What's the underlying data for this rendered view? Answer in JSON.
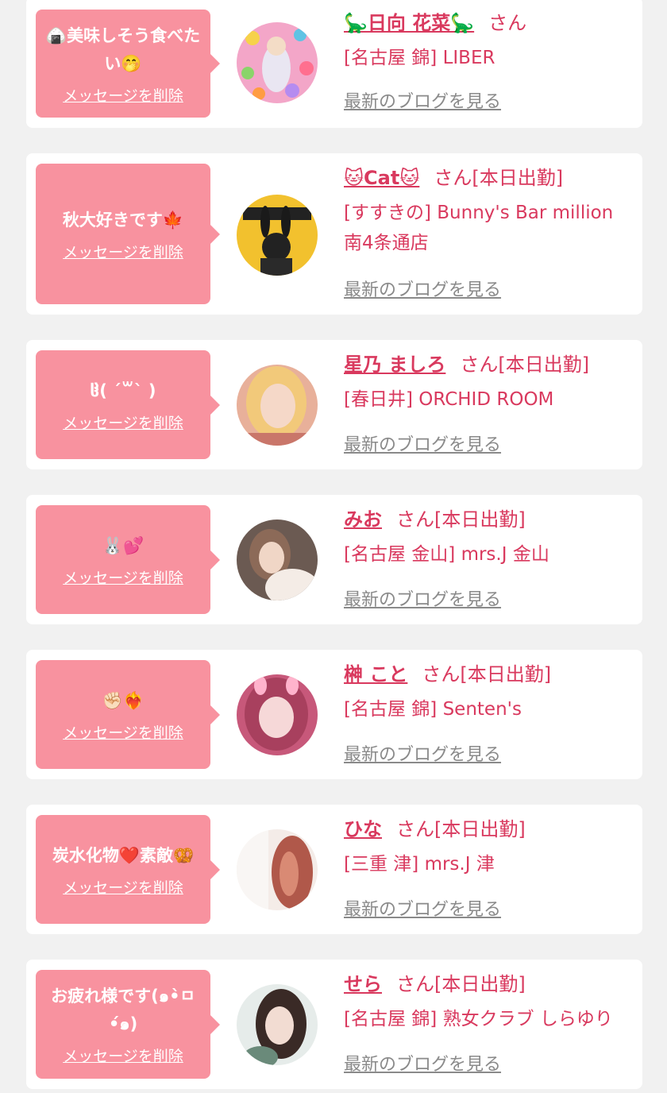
{
  "delete_label": "メッセージを削除",
  "blog_label": "最新のブログを見る",
  "colors": {
    "accent_pink": "#f8929f",
    "name_red": "#d9395e",
    "link_gray": "#8a8a8a",
    "background": "#f1f1f1"
  },
  "entries": [
    {
      "message": "🍙美味しそう食べたい🤭",
      "name": "🦕日向 花菜🦕",
      "suffix": "さん",
      "shop": "[名古屋 錦] LIBER",
      "avatar_icon": "avatar-photo"
    },
    {
      "message": "秋大好きです🍁",
      "name": "🐱Cat🐱",
      "suffix": "さん[本日出勤]",
      "shop": "[すすきの] Bunny's Bar million 南4条通店",
      "avatar_icon": "avatar-photo"
    },
    {
      "message": "ჱ̒( ˊ꒳ˋ )",
      "name": "星乃 ましろ",
      "suffix": "さん[本日出勤]",
      "shop": "[春日井] ORCHID ROOM",
      "avatar_icon": "avatar-photo"
    },
    {
      "message": "🐰💕",
      "name": "みお",
      "suffix": "さん[本日出勤]",
      "shop": "[名古屋 金山] mrs.J 金山",
      "avatar_icon": "avatar-photo"
    },
    {
      "message": "✊🏻❤️‍🔥",
      "name": "榊 こと",
      "suffix": "さん[本日出勤]",
      "shop": "[名古屋 錦] Senten's",
      "avatar_icon": "avatar-photo"
    },
    {
      "message": "炭水化物❤️素敵🥨",
      "name": "ひな",
      "suffix": "さん[本日出勤]",
      "shop": "[三重 津] mrs.J 津",
      "avatar_icon": "avatar-photo"
    },
    {
      "message": "お疲れ様です(๑•̀ㅁ•́๑)",
      "name": "せら",
      "suffix": "さん[本日出勤]",
      "shop": "[名古屋 錦] 熟女クラブ しらゆり",
      "avatar_icon": "avatar-photo"
    }
  ]
}
